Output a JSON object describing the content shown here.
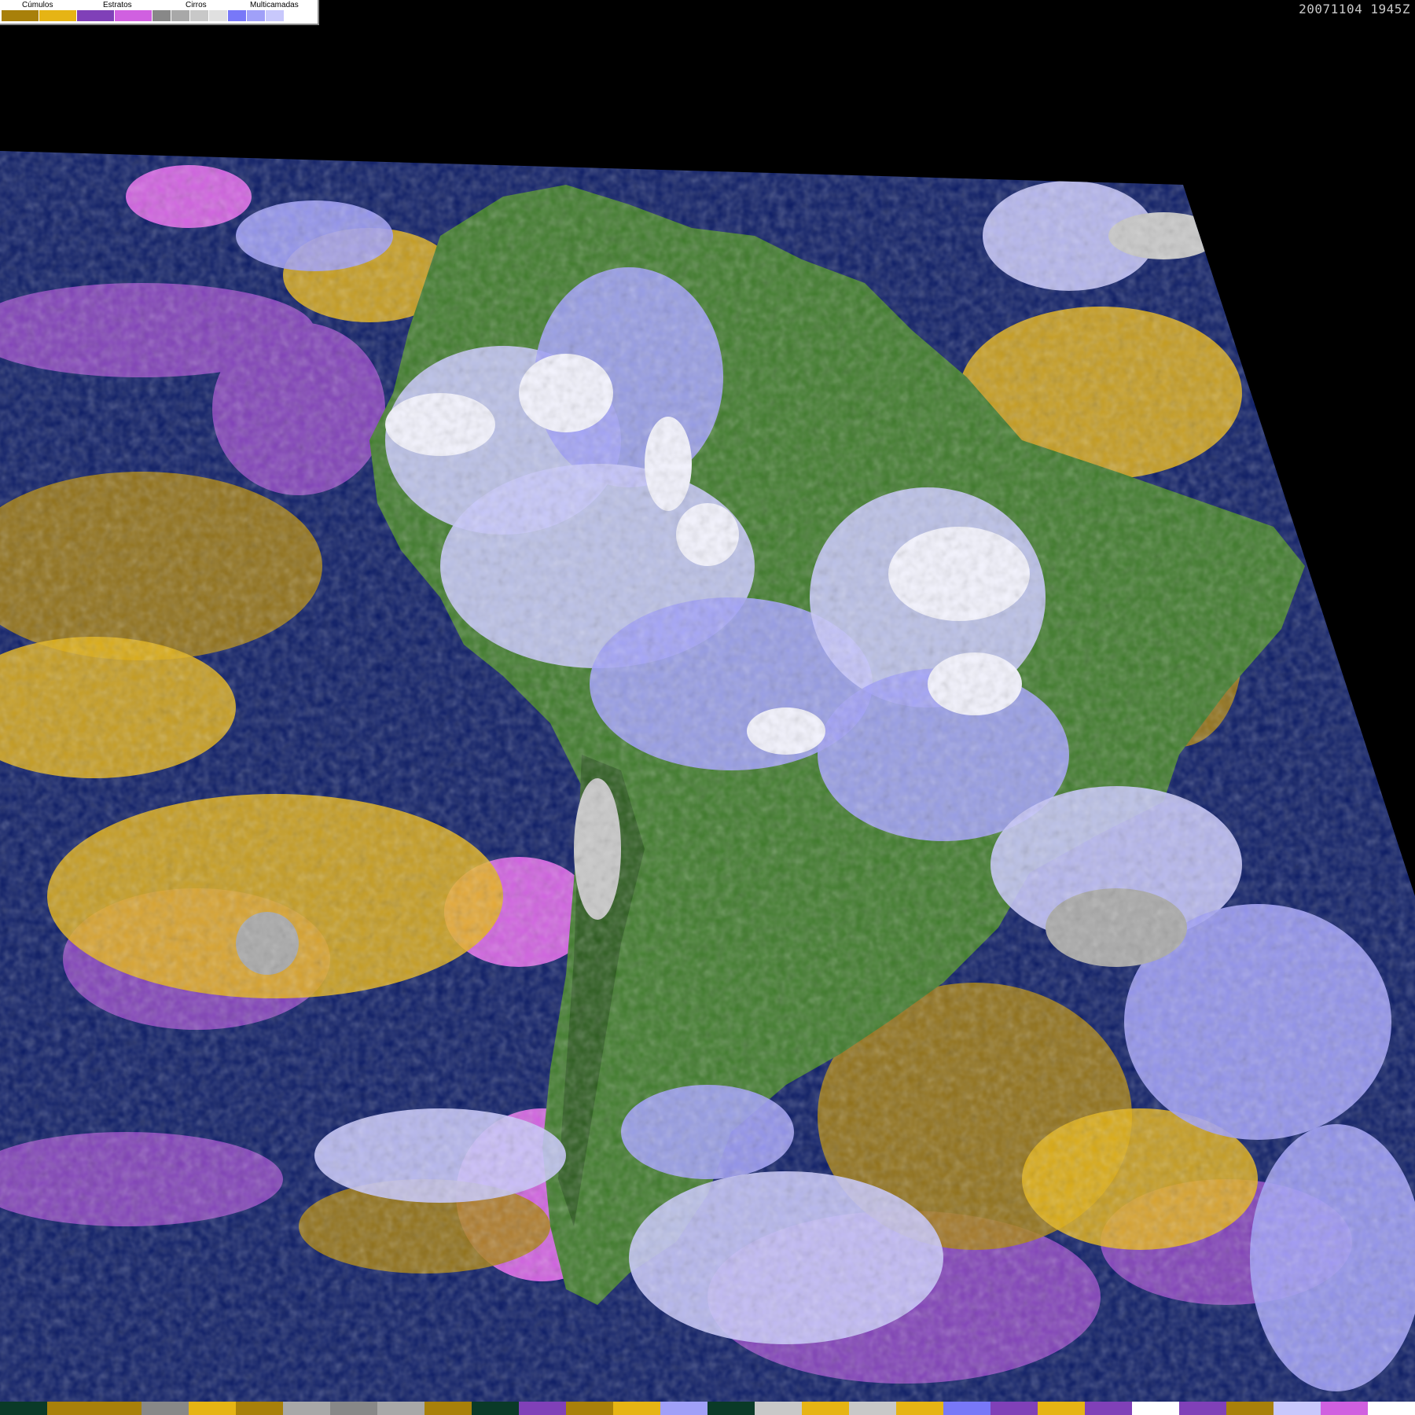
{
  "timestamp": "20071104 1945Z",
  "legend": {
    "groups": [
      {
        "label": "Cúmulos",
        "colors": [
          "#a8800a",
          "#e6b414"
        ]
      },
      {
        "label": "Estratos",
        "colors": [
          "#8040b8",
          "#d060e0"
        ]
      },
      {
        "label": "Cirros",
        "colors": [
          "#888888",
          "#a8a8a8",
          "#c8c8c8",
          "#e0e0e0"
        ]
      },
      {
        "label": "Multicamadas",
        "colors": [
          "#7878f8",
          "#a0a0f8",
          "#c8c8fc",
          "#ffffff"
        ]
      }
    ]
  },
  "colors": {
    "background": "#000000",
    "ocean": "#0a1a64",
    "land": "#3e7a2a",
    "land_dark": "#2a5a1c",
    "cumulus_low": "#a8800a",
    "cumulus_high": "#e6b414",
    "stratus": "#8040b8",
    "stratus_light": "#d060e0",
    "cirrus": "#a8a8a8",
    "cirrus_light": "#c8c8c8",
    "multilayer": "#a0a0f8",
    "multilayer_light": "#c8c8fc",
    "multilayer_white": "#f4f4ff"
  },
  "bottom_palette": [
    "#0a3a28",
    "#a8800a",
    "#a8800a",
    "#888888",
    "#e6b414",
    "#a8800a",
    "#a8a8a8",
    "#888888",
    "#a8a8a8",
    "#a8800a",
    "#0a3a28",
    "#8040b8",
    "#a8800a",
    "#e6b414",
    "#a0a0f8",
    "#0a3a28",
    "#c8c8c8",
    "#e6b414",
    "#c8c8c8",
    "#e6b414",
    "#7878f8",
    "#8040b8",
    "#e6b414",
    "#8040b8",
    "#ffffff",
    "#8040b8",
    "#a8800a",
    "#c8c8fc",
    "#d060e0",
    "#ffffff"
  ]
}
